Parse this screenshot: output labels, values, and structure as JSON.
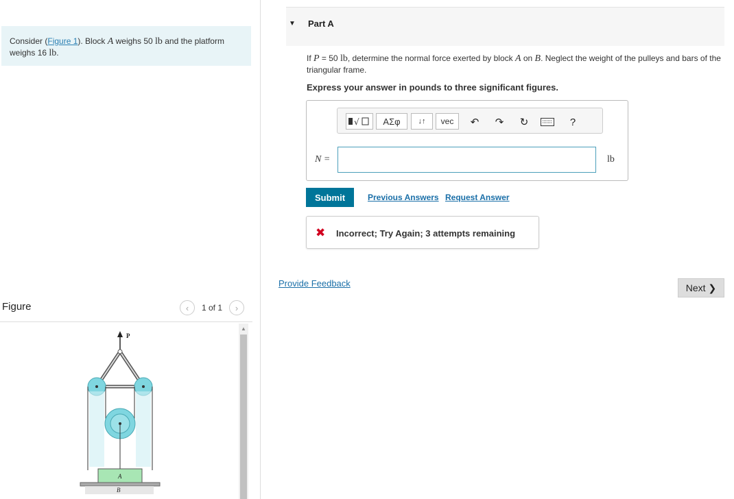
{
  "problem": {
    "text_before_link": "Consider (",
    "link_text": "Figure 1",
    "text_after_link": "). Block ",
    "block_var": "A",
    "text_weighs": " weighs 50 ",
    "unit1": "lb",
    "text_platform": " and the platform weighs 16 ",
    "unit2": "lb",
    "text_end": "."
  },
  "figure": {
    "title": "Figure",
    "pager_text": "1 of 1",
    "labels": {
      "p": "P",
      "a": "A",
      "b": "B"
    }
  },
  "part": {
    "title": "Part A",
    "q_if": "If ",
    "q_var_p": "P",
    "q_eq": " = 50 ",
    "q_unit": "lb",
    "q_mid": ", determine the normal force exerted by block ",
    "q_var_a": "A",
    "q_on": " on ",
    "q_var_b": "B",
    "q_end": ". Neglect the weight of the pulleys and bars of the triangular frame.",
    "instructions": "Express your answer in pounds to three significant figures."
  },
  "toolbar": {
    "greek_label": "ΑΣφ",
    "arrows_label": "↓↑",
    "vec_label": "vec",
    "help_label": "?"
  },
  "answer": {
    "var_label": "N =",
    "value": "",
    "unit": "lb"
  },
  "actions": {
    "submit": "Submit",
    "previous_answers": "Previous Answers",
    "request_answer": "Request Answer"
  },
  "feedback": {
    "message": "Incorrect; Try Again; 3 attempts remaining"
  },
  "footer": {
    "provide_feedback": "Provide Feedback",
    "next": "Next"
  },
  "colors": {
    "problem_bg": "#e8f4f7",
    "submit_bg": "#007599",
    "link": "#1a6fa8",
    "error": "#d1001f",
    "pulley": "#7fd6e0",
    "block": "#a8e6b4"
  }
}
